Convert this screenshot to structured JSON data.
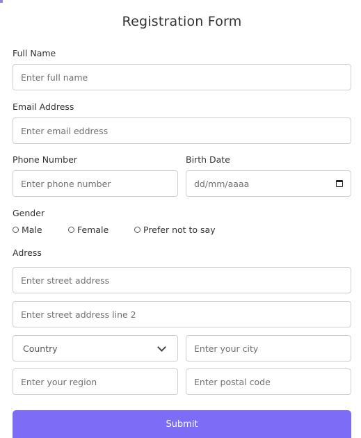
{
  "form": {
    "title": "Registration Form",
    "full_name": {
      "label": "Full Name",
      "placeholder": "Enter full name"
    },
    "email": {
      "label": "Email Address",
      "placeholder": "Enter email eddress"
    },
    "phone": {
      "label": "Phone Number",
      "placeholder": "Enter phone number"
    },
    "birth_date": {
      "label": "Birth Date",
      "placeholder": "dd/mm/aaaa"
    },
    "gender": {
      "label": "Gender",
      "options": [
        "Male",
        "Female",
        "Prefer not to say"
      ]
    },
    "address": {
      "label": "Adress",
      "line1_placeholder": "Enter street address",
      "line2_placeholder": "Enter street address line 2",
      "country_selected": "Country",
      "city_placeholder": "Enter your city",
      "region_placeholder": "Enter your region",
      "postal_placeholder": "Enter postal code"
    },
    "submit_label": "Submit"
  },
  "colors": {
    "accent": "#7d6cf6",
    "border": "#cfcfcf"
  },
  "icons": {
    "birth_date": "calendar-icon",
    "country": "chevron-down-icon"
  }
}
